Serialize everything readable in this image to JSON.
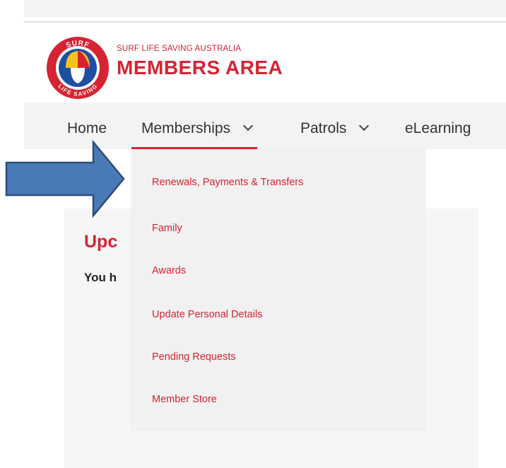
{
  "header": {
    "org_name": "SURF LIFE SAVING AUSTRALIA",
    "title": "MEMBERS AREA"
  },
  "logo": {
    "top_text": "SURF",
    "bottom_text": "LIFE SAVING",
    "colors": {
      "ring": "#d62332",
      "inner": "#1e4fa3",
      "cap_yellow": "#f3c21d"
    }
  },
  "nav": {
    "items": [
      {
        "label": "Home"
      },
      {
        "label": "Memberships"
      },
      {
        "label": "Patrols"
      },
      {
        "label": "eLearning"
      }
    ]
  },
  "dropdown": {
    "items": [
      {
        "label": "Renewals, Payments & Transfers"
      },
      {
        "label": "Family"
      },
      {
        "label": "Awards"
      },
      {
        "label": "Update Personal Details"
      },
      {
        "label": "Pending Requests"
      },
      {
        "label": "Member Store"
      }
    ]
  },
  "content": {
    "title": "Upc",
    "text": "You h"
  },
  "colors": {
    "brand_red": "#d62332",
    "nav_bg": "#f3f3f3",
    "arrow_fill": "#4a7ab6",
    "arrow_stroke": "#2a4d7a"
  }
}
